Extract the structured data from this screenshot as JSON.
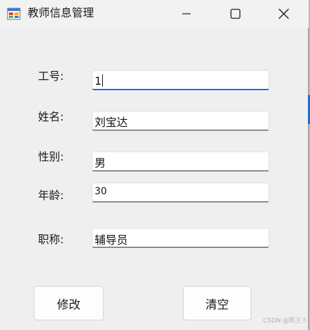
{
  "window": {
    "title": "教师信息管理",
    "icon": "windows-form-icon"
  },
  "titlebar_buttons": {
    "minimize": "minimize-icon",
    "maximize": "maximize-icon",
    "close": "close-icon"
  },
  "form": {
    "fields": [
      {
        "label": "工号:",
        "value": "1",
        "focused": true
      },
      {
        "label": "姓名:",
        "value": "刘宝达",
        "focused": false
      },
      {
        "label": "性别:",
        "value": "男",
        "focused": false
      },
      {
        "label": "年龄:",
        "value": "30",
        "focused": false
      },
      {
        "label": "职称:",
        "value": "辅导员",
        "focused": false
      }
    ]
  },
  "buttons": {
    "modify_label": "修改",
    "clear_label": "清空"
  },
  "watermark": "CSDN @陈王卜",
  "colors": {
    "accent": "#1b6fcf",
    "window_bg": "#f0eff0"
  }
}
